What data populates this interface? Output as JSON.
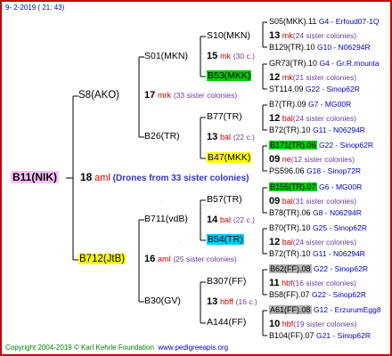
{
  "header": {
    "date": "9-  2-2019  ( 21: 43)"
  },
  "root": {
    "name": "B11(NIK)",
    "num": "18",
    "loc": "aml",
    "note": "(Drones from 33 sister colonies)"
  },
  "sire": {
    "name": "S8(AKO)",
    "num": "17",
    "loc": "mrk",
    "sis": "(33 sister colonies)"
  },
  "dam": {
    "name": "B712(JtB)",
    "num": "16",
    "loc": "aml",
    "sis": "(25 sister colonies)"
  },
  "l2": [
    {
      "name": "S01(MKN)"
    },
    {
      "name": "B26(TR)"
    },
    {
      "name": "B711(vdB)"
    },
    {
      "name": "B30(GV)"
    }
  ],
  "l3": [
    {
      "name": "S10(MKN)"
    },
    {
      "name": "B53(MKK)"
    },
    {
      "name": "B77(TR)"
    },
    {
      "name": "B47(MKK)"
    },
    {
      "name": "B57(TR)"
    },
    {
      "name": "B54(TR)"
    },
    {
      "name": "B307(FF)"
    },
    {
      "name": "A144(FF)"
    }
  ],
  "l3info": [
    {
      "num": "15",
      "loc": "mk",
      "sis": "(30 c.)"
    },
    {
      "num": "13",
      "loc": "bal",
      "sis": "(22 c.)"
    },
    {
      "num": "14",
      "loc": "bal",
      "sis": "(22 c.)"
    },
    {
      "num": "13",
      "loc": "hbff",
      "sis": "(16 c.)"
    }
  ],
  "l4": [
    {
      "name": "S05(MKK).11",
      "code": "G4 - Erfoud07-1Q",
      "hl": ""
    },
    {
      "num": "13",
      "loc": "mk",
      "sis": "(24 sister colonies)"
    },
    {
      "name": "B129(TR).10",
      "code": "G10 - N06294R",
      "hl": ""
    },
    {
      "name": "GR73(TR).10",
      "code": "G4 - Gr.R.mounta",
      "hl": ""
    },
    {
      "num": "12",
      "loc": "mk",
      "sis": "(21 sister colonies)"
    },
    {
      "name": "ST114.09",
      "code": "G22 - Sinop62R",
      "hl": ""
    },
    {
      "name": "B7(TR).09",
      "code": "G7 - MG00R",
      "hl": ""
    },
    {
      "num": "12",
      "loc": "bal",
      "sis": "(24 sister colonies)"
    },
    {
      "name": "B72(TR).10",
      "code": "G11 - N06294R",
      "hl": ""
    },
    {
      "name": "B171(TR).06",
      "code": "G22 - Sinop62R",
      "hl": "g"
    },
    {
      "num": "09",
      "loc": "ne",
      "sis": "(12 sister colonies)"
    },
    {
      "name": "PS596.06",
      "code": "G18 - Sinop72R",
      "hl": ""
    },
    {
      "name": "B155(TR).07",
      "code": "G6 - MG00R",
      "hl": "g"
    },
    {
      "num": "09",
      "loc": "bal",
      "sis": "(31 sister colonies)"
    },
    {
      "name": "B78(TR).06",
      "code": "G8 - N06294R",
      "hl": ""
    },
    {
      "name": "B70(TR).10",
      "code": "G25 - Sinop62R",
      "hl": ""
    },
    {
      "num": "12",
      "loc": "bal",
      "sis": "(24 sister colonies)"
    },
    {
      "name": "B72(TR).10",
      "code": "G11 - N06294R",
      "hl": ""
    },
    {
      "name": "B62(FF).08",
      "code": "G22 - Sinop62R",
      "hl": "gr"
    },
    {
      "num": "11",
      "loc": "hbf",
      "sis": "(16 sister colonies)"
    },
    {
      "name": "B58(FF).07",
      "code": "G22 - Sinop62R",
      "hl": ""
    },
    {
      "name": "A61(FF).08",
      "code": "G12 - ErzurumEgg8",
      "hl": "gr"
    },
    {
      "num": "10",
      "loc": "hbf",
      "sis": "(19 sister colonies)"
    },
    {
      "name": "B104(FF).07",
      "code": "G21 - Sinop62R",
      "hl": ""
    }
  ],
  "footer": {
    "copyright": "Copyright 2004-2019 © Karl Kehrle Foundation",
    "site": "www.pedigreeapis.org"
  },
  "colors": {
    "border": "#cc0000",
    "root_bg": "#ffc0ff",
    "yellow": "#ffff00",
    "green": "#00cc00",
    "cyan": "#00ccff",
    "gray": "#b4b4b4",
    "code": "#0000cc"
  }
}
